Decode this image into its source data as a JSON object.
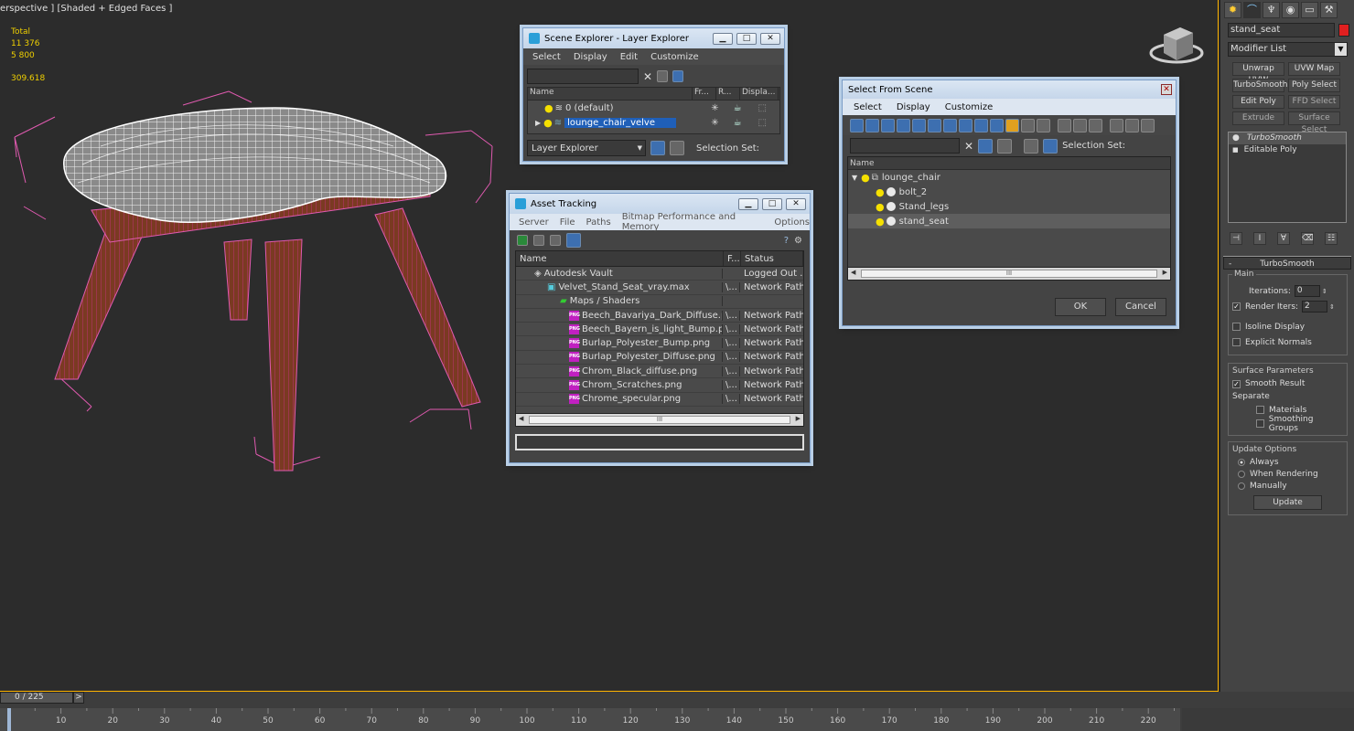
{
  "viewport": {
    "label": "erspective ] [Shaded + Edged Faces ]",
    "stats": {
      "total_label": "Total",
      "polys": "11 376",
      "verts": "5 800",
      "fps": "309.618"
    }
  },
  "scene_explorer": {
    "title": "Scene Explorer - Layer Explorer",
    "menu": [
      "Select",
      "Display",
      "Edit",
      "Customize"
    ],
    "search_value": "",
    "columns": [
      "Name",
      "Fr...",
      "R...",
      "Displa..."
    ],
    "rows": [
      "0 (default)",
      "lounge_chair_velve"
    ],
    "explorer_type": "Layer Explorer",
    "selection_set_label": "Selection Set:"
  },
  "asset_tracking": {
    "title": "Asset Tracking",
    "menu": [
      "Server",
      "File",
      "Paths",
      "Bitmap Performance and Memory",
      "Options"
    ],
    "columns": [
      "Name",
      "F...",
      "Status"
    ],
    "rows": [
      {
        "name": "Autodesk Vault",
        "f": "",
        "status": "Logged Out ..."
      },
      {
        "name": "Velvet_Stand_Seat_vray.max",
        "f": "\\...",
        "status": "Network Path"
      },
      {
        "name": "Maps / Shaders",
        "f": "",
        "status": ""
      },
      {
        "name": "Beech_Bavariya_Dark_Diffuse.png",
        "f": "\\...",
        "status": "Network Path"
      },
      {
        "name": "Beech_Bayern_is_light_Bump.png",
        "f": "\\...",
        "status": "Network Path"
      },
      {
        "name": "Burlap_Polyester_Bump.png",
        "f": "\\...",
        "status": "Network Path"
      },
      {
        "name": "Burlap_Polyester_Diffuse.png",
        "f": "\\...",
        "status": "Network Path"
      },
      {
        "name": "Chrom_Black_diffuse.png",
        "f": "\\...",
        "status": "Network Path"
      },
      {
        "name": "Chrom_Scratches.png",
        "f": "\\...",
        "status": "Network Path"
      },
      {
        "name": "Chrome_specular.png",
        "f": "\\...",
        "status": "Network Path"
      }
    ],
    "scroll_mark": "III"
  },
  "select_from_scene": {
    "title": "Select From Scene",
    "menu": [
      "Select",
      "Display",
      "Customize"
    ],
    "selection_set_label": "Selection Set:",
    "column": "Name",
    "rows": [
      "lounge_chair",
      "bolt_2",
      "Stand_legs",
      "stand_seat"
    ],
    "ok_label": "OK",
    "cancel_label": "Cancel",
    "scroll_mark": "III"
  },
  "command_panel": {
    "object_name": "stand_seat",
    "object_color": "#e02020",
    "modifier_list": "Modifier List",
    "modifier_buttons": [
      "Unwrap UVW",
      "UVW Map",
      "TurboSmooth",
      "Poly Select",
      "Edit Poly",
      "FFD Select",
      "Extrude",
      "Surface Select"
    ],
    "stack": [
      "TurboSmooth",
      "Editable Poly"
    ],
    "rollout_title": "TurboSmooth",
    "main_label": "Main",
    "iterations_label": "Iterations:",
    "iterations_value": "0",
    "render_iters_label": "Render Iters:",
    "render_iters_value": "2",
    "isoline_label": "Isoline Display",
    "explicit_normals_label": "Explicit Normals",
    "surface_params_label": "Surface Parameters",
    "smooth_result_label": "Smooth Result",
    "separate_label": "Separate",
    "materials_label": "Materials",
    "smoothing_groups_label": "Smoothing Groups",
    "update_options_label": "Update Options",
    "always_label": "Always",
    "when_rendering_label": "When Rendering",
    "manually_label": "Manually",
    "update_button": "Update"
  },
  "timeline": {
    "frame_display": "0 / 225",
    "next_label": ">",
    "ticks": [
      "10",
      "20",
      "30",
      "40",
      "50",
      "60",
      "70",
      "80",
      "90",
      "100",
      "110",
      "120",
      "130",
      "140",
      "150",
      "160",
      "170",
      "180",
      "190",
      "200",
      "210",
      "220"
    ]
  }
}
